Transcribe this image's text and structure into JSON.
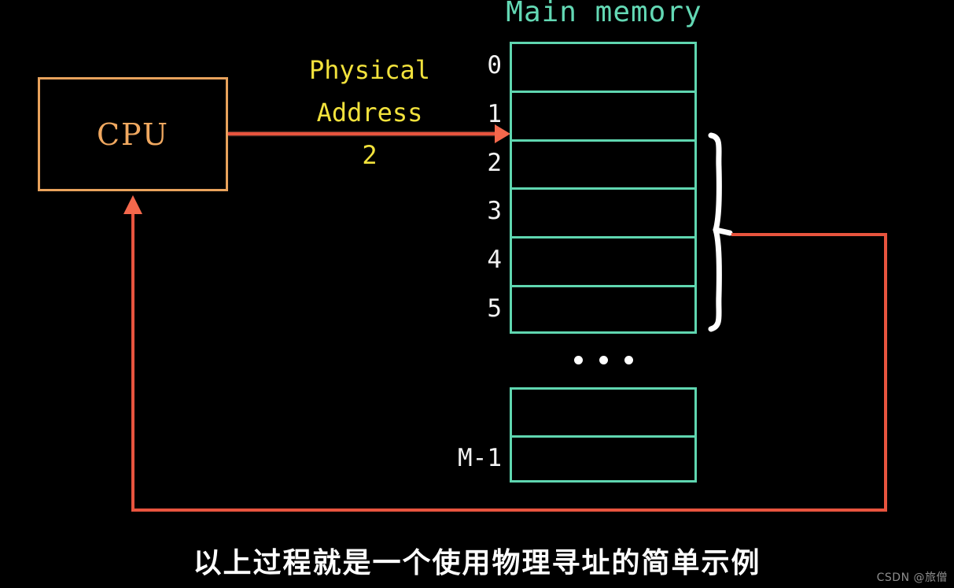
{
  "diagram": {
    "title": "Main memory",
    "title_color": "#63d8b4",
    "background_color": "#000000",
    "cpu": {
      "label": "CPU",
      "border_color": "#e8a25c",
      "text_color": "#f0a860"
    },
    "physical_address": {
      "line1": "Physical",
      "line2": "Address",
      "line3": "2",
      "color": "#f2e23c"
    },
    "arrow_color": "#e8543e",
    "memory": {
      "cell_border_color": "#5fd6b0",
      "index_color": "#f2f2f2",
      "top_rows": [
        {
          "index": "0"
        },
        {
          "index": "1"
        },
        {
          "index": "2"
        },
        {
          "index": "3"
        },
        {
          "index": "4"
        },
        {
          "index": "5"
        }
      ],
      "ellipsis": "• • •",
      "bottom_rows": [
        {
          "index": ""
        },
        {
          "index": "M-1"
        }
      ]
    },
    "brace_color": "#ffffff"
  },
  "caption": {
    "text": "以上过程就是一个使用物理寻址的简单示例"
  },
  "watermark": {
    "text": "CSDN @旅僧"
  }
}
